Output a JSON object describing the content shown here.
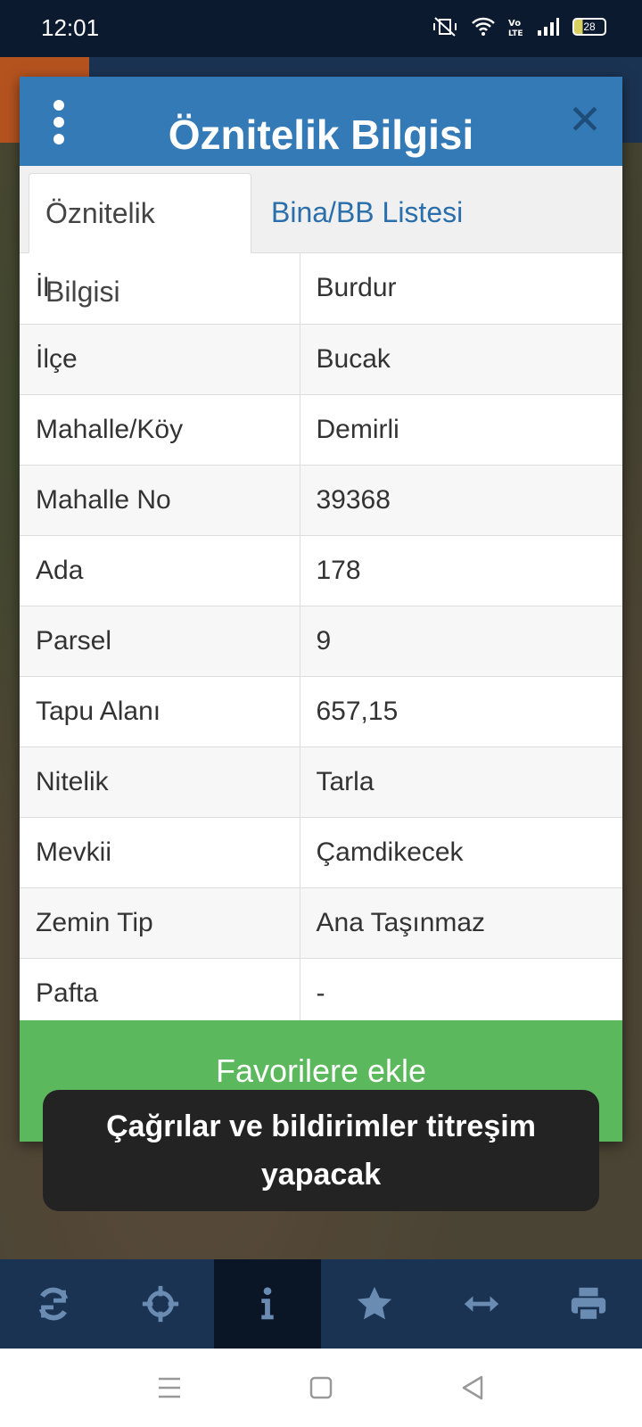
{
  "status_bar": {
    "time": "12:01",
    "battery": "28"
  },
  "modal": {
    "title": "Öznitelik Bilgisi",
    "tabs": [
      {
        "label": "Öznitelik Bilgisi",
        "active": true
      },
      {
        "label": "Bina/BB Listesi",
        "active": false
      }
    ],
    "rows": [
      {
        "key": "İl",
        "value": "Burdur"
      },
      {
        "key": "İlçe",
        "value": "Bucak"
      },
      {
        "key": "Mahalle/Köy",
        "value": "Demirli"
      },
      {
        "key": "Mahalle No",
        "value": "39368"
      },
      {
        "key": "Ada",
        "value": "178"
      },
      {
        "key": "Parsel",
        "value": "9"
      },
      {
        "key": "Tapu Alanı",
        "value": "657,15"
      },
      {
        "key": "Nitelik",
        "value": "Tarla"
      },
      {
        "key": "Mevkii",
        "value": "Çamdikecek"
      },
      {
        "key": "Zemin Tip",
        "value": "Ana Taşınmaz"
      },
      {
        "key": "Pafta",
        "value": "-"
      }
    ],
    "favorite_button": "Favorilere ekle"
  },
  "toast": {
    "line1": "Çağrılar ve bildirimler titreşim",
    "line2": "yapacak"
  },
  "toolbar": {
    "items": [
      {
        "icon": "refresh-icon"
      },
      {
        "icon": "crosshair-icon"
      },
      {
        "icon": "info-icon",
        "active": true
      },
      {
        "icon": "star-icon"
      },
      {
        "icon": "arrows-horizontal-icon"
      },
      {
        "icon": "print-icon"
      }
    ]
  },
  "colors": {
    "header": "#337ab7",
    "favorite": "#5cb85c",
    "toolbar": "#1b3352"
  }
}
